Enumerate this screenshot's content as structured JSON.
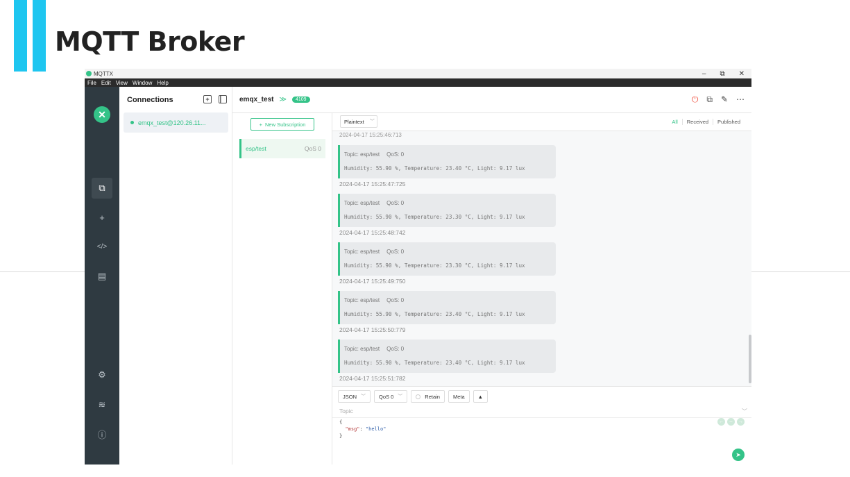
{
  "slide": {
    "title": "MQTT Broker",
    "accent_color": "#1ec6f0"
  },
  "window": {
    "title": "MQTTX",
    "controls": {
      "minimize": "–",
      "restore": "⧉",
      "close": "✕"
    },
    "menu": [
      "File",
      "Edit",
      "View",
      "Window",
      "Help"
    ]
  },
  "sidebar": {
    "logo": "✕",
    "items": [
      {
        "icon": "connections-icon",
        "glyph": "⧉"
      },
      {
        "icon": "add-icon",
        "glyph": "+"
      },
      {
        "icon": "script-icon",
        "glyph": "</>"
      },
      {
        "icon": "log-icon",
        "glyph": "▤"
      },
      {
        "icon": "settings-icon",
        "glyph": "⚙"
      },
      {
        "icon": "subscribe-feed-icon",
        "glyph": "≋"
      },
      {
        "icon": "about-icon",
        "glyph": "ⓘ"
      }
    ]
  },
  "connections": {
    "header": "Connections",
    "items": [
      {
        "label": "emqx_test@120.26.11..."
      }
    ]
  },
  "topbar": {
    "name": "emqx_test",
    "chevron": "≫",
    "count": "4109",
    "accent": "#34c388"
  },
  "subscriptions": {
    "new_label": "New Subscription",
    "items": [
      {
        "topic": "esp/test",
        "qos": "QoS 0"
      }
    ]
  },
  "messages": {
    "format": "Plaintext",
    "filters": [
      "All",
      "Received",
      "Published"
    ],
    "cut_time": "2024-04-17 15:25:46:713",
    "list": [
      {
        "topic": "Topic: esp/test",
        "qos": "QoS: 0",
        "body": "Humidity: 55.90 %, Temperature: 23.40 °C, Light: 9.17 lux",
        "time": "2024-04-17 15:25:47:725"
      },
      {
        "topic": "Topic: esp/test",
        "qos": "QoS: 0",
        "body": "Humidity: 55.90 %, Temperature: 23.30 °C, Light: 9.17 lux",
        "time": "2024-04-17 15:25:48:742"
      },
      {
        "topic": "Topic: esp/test",
        "qos": "QoS: 0",
        "body": "Humidity: 55.90 %, Temperature: 23.30 °C, Light: 9.17 lux",
        "time": "2024-04-17 15:25:49:750"
      },
      {
        "topic": "Topic: esp/test",
        "qos": "QoS: 0",
        "body": "Humidity: 55.90 %, Temperature: 23.40 °C, Light: 9.17 lux",
        "time": "2024-04-17 15:25:50:779"
      },
      {
        "topic": "Topic: esp/test",
        "qos": "QoS: 0",
        "body": "Humidity: 55.90 %, Temperature: 23.40 °C, Light: 9.17 lux",
        "time": "2024-04-17 15:25:51:782"
      }
    ]
  },
  "publish": {
    "format": "JSON",
    "qos": "QoS 0",
    "retain": "Retain",
    "meta": "Meta",
    "topic_placeholder": "Topic",
    "payload_open": "{",
    "payload_key": "\"msg\"",
    "payload_value": "\"hello\"",
    "payload_close": "}"
  }
}
